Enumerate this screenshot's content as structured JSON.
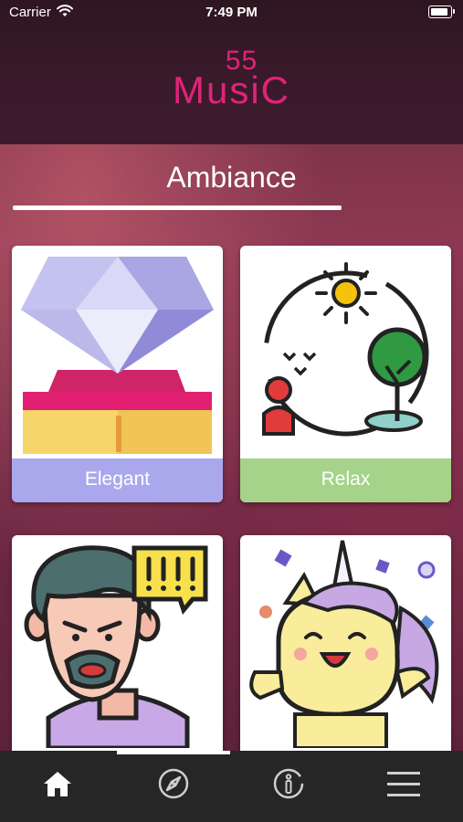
{
  "status_bar": {
    "carrier": "Carrier",
    "time": "7:49 PM"
  },
  "header": {
    "logo_number": "55",
    "logo_text": "MusiC"
  },
  "section": {
    "title": "Ambiance"
  },
  "cards": [
    {
      "label": "Elegant",
      "color": "#aaa8ec",
      "icon": "diamond-icon"
    },
    {
      "label": "Relax",
      "color": "#a4d389",
      "icon": "nature-relax-icon"
    },
    {
      "label": "",
      "color": "#e8b2a0",
      "icon": "angry-man-icon"
    },
    {
      "label": "",
      "color": "#f3e17a",
      "icon": "unicorn-icon"
    }
  ],
  "tabbar": {
    "tabs": [
      {
        "icon": "home-icon",
        "active": true
      },
      {
        "icon": "compass-icon",
        "active": false
      },
      {
        "icon": "info-icon",
        "active": false
      },
      {
        "icon": "menu-icon",
        "active": false
      }
    ]
  }
}
